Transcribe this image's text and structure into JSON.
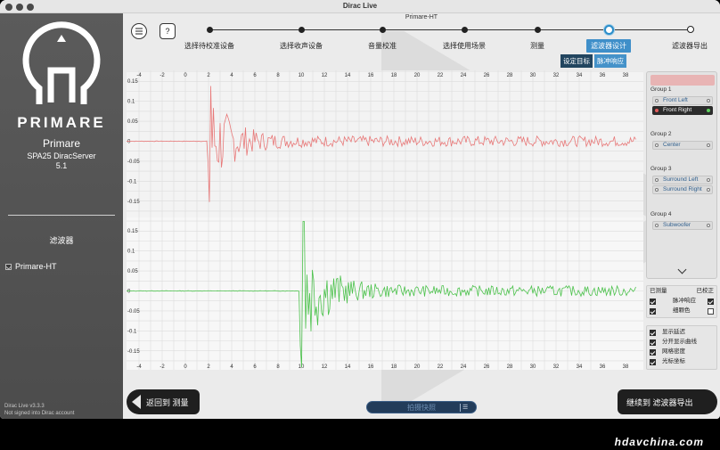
{
  "window": {
    "title": "Dirac Live"
  },
  "sidebar": {
    "brand_text": "PRIMARE",
    "product_name": "Primare",
    "server_name": "SPA25 DiracServer",
    "server_version": "5.1",
    "section_title": "滤波器",
    "filters": [
      {
        "label": "Primare-HT",
        "checked": true
      }
    ],
    "version_text": "Dirac Live v3.3.3",
    "login_status": "Not signed into Dirac account"
  },
  "header": {
    "menu_icon": "menu-icon",
    "help_label": "?",
    "project_name": "Primare-HT",
    "steps": [
      {
        "label": "选择待校准设备",
        "state": "done"
      },
      {
        "label": "选择收声设备",
        "state": "done"
      },
      {
        "label": "音量校准",
        "state": "done"
      },
      {
        "label": "选择使用场景",
        "state": "done"
      },
      {
        "label": "测量",
        "state": "done"
      },
      {
        "label": "滤波器设计",
        "state": "active"
      },
      {
        "label": "滤波器导出",
        "state": "todo"
      }
    ],
    "subtabs": [
      {
        "label": "设定目标",
        "active": false
      },
      {
        "label": "脉冲响应",
        "active": true
      }
    ]
  },
  "plots": {
    "x_ticks": [
      "-4",
      "-2",
      "0",
      "2",
      "4",
      "6",
      "8",
      "10",
      "12",
      "14",
      "16",
      "18",
      "20",
      "22",
      "24",
      "26",
      "28",
      "30",
      "32",
      "34",
      "36",
      "38"
    ],
    "top": {
      "y_ticks": [
        "0.15",
        "0.1",
        "0.05",
        "0",
        "-0.05",
        "-0.1",
        "-0.15"
      ],
      "color": "#e87878"
    },
    "bottom": {
      "y_ticks": [
        "0.15",
        "0.1",
        "0.05",
        "0",
        "-0.05",
        "-0.1",
        "-0.15"
      ],
      "color": "#4cc24c"
    }
  },
  "groups": [
    {
      "title": "Group 1",
      "speakers": [
        {
          "label": "Front Left",
          "selected": false
        },
        {
          "label": "Front Right",
          "selected": true
        }
      ]
    },
    {
      "title": "Group 2",
      "speakers": [
        {
          "label": "Center",
          "selected": false
        }
      ]
    },
    {
      "title": "Group 3",
      "speakers": [
        {
          "label": "Surround Left",
          "selected": false
        },
        {
          "label": "Surround Right",
          "selected": false
        }
      ]
    },
    {
      "title": "Group 4",
      "speakers": [
        {
          "label": "Subwoofer",
          "selected": false
        }
      ]
    }
  ],
  "options": {
    "header_left": "已测量",
    "header_right": "已校正",
    "rows": [
      {
        "label": "脉冲响应",
        "left": true,
        "right": true
      },
      {
        "label": "细颗色",
        "left": true,
        "right": false
      }
    ],
    "display": [
      {
        "label": "显示延迟",
        "checked": true
      },
      {
        "label": "分开显示曲线",
        "checked": true
      },
      {
        "label": "网格密度",
        "checked": true
      },
      {
        "label": "光标坐标",
        "checked": true
      }
    ]
  },
  "footer": {
    "back_label": "返回到 测量",
    "next_label": "继续到 滤波器导出",
    "snapshot_label": "拍摄快照",
    "colors": {
      "dark": "#1f1f1f",
      "accent": "#3f8fc9"
    }
  },
  "overlay": {
    "site_url": "hdavchina.com"
  }
}
